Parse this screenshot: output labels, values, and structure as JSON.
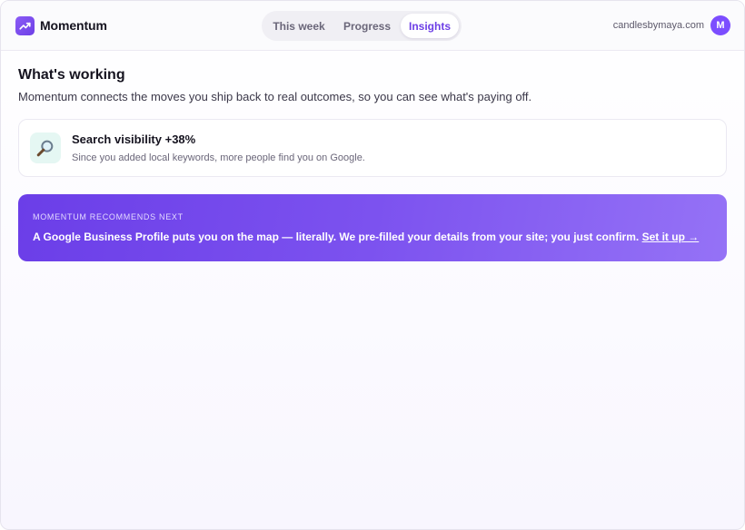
{
  "app": {
    "name": "Momentum",
    "logo_icon": "trending-up-icon"
  },
  "nav": {
    "tabs": [
      {
        "label": "This week",
        "active": false
      },
      {
        "label": "Progress",
        "active": false
      },
      {
        "label": "Insights",
        "active": true
      }
    ]
  },
  "account": {
    "domain": "candlesbymaya.com",
    "avatar_initial": "M"
  },
  "page": {
    "title": "What's working",
    "subtitle": "Momentum connects the moves you ship back to real outcomes, so you can see what's paying off."
  },
  "wins": [
    {
      "icon": "magnifying-glass-icon",
      "title": "Search visibility +38%",
      "description": "Since you added local keywords, more people find you on Google."
    }
  ],
  "recommendation": {
    "label": "MOMENTUM RECOMMENDS NEXT",
    "text": "A Google Business Profile puts you on the map — literally. We pre-filled your details from your site; you just confirm.",
    "link_label": "Set it up →"
  },
  "colors": {
    "accent": "#6d3fe6",
    "avatar": "#7c4dff",
    "win_icon_bg": "#e5f7f3",
    "reco_gradient_start": "#6b3ee8",
    "reco_gradient_end": "#9572f6"
  }
}
